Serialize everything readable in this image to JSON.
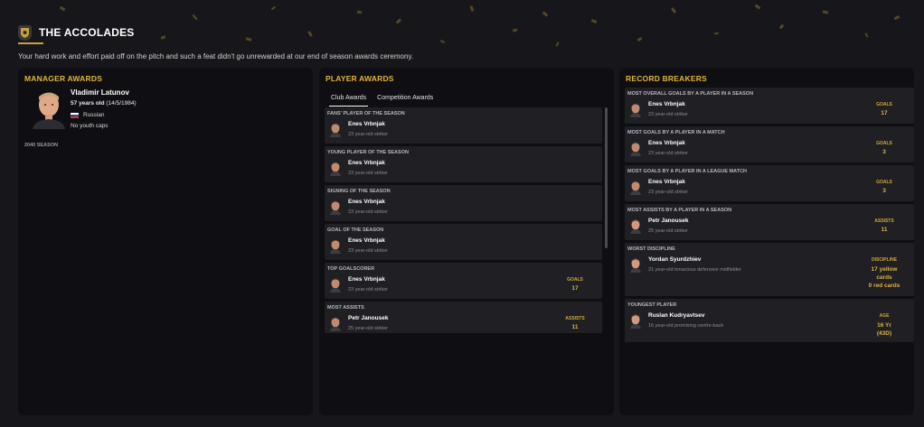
{
  "header": {
    "title": "THE ACCOLADES",
    "subtitle": "Your hard work and effort paid off on the pitch and such a feat didn't go unrewarded at our end of season awards ceremony."
  },
  "manager": {
    "panel_title": "MANAGER AWARDS",
    "name": "Vladimir Latunov",
    "age_bold": "57 years old",
    "age_dob": " (14/5/1984)",
    "nationality": "Russian",
    "caps": "No youth caps",
    "season": "2040 SEASON"
  },
  "player_awards": {
    "panel_title": "PLAYER AWARDS",
    "tabs": [
      "Club Awards",
      "Competition Awards"
    ],
    "awards": [
      {
        "title": "FANS' PLAYER OF THE SEASON",
        "player": "Enes Vrbnjak",
        "desc": "23 year-old striker",
        "stat_label": "",
        "stat_value": ""
      },
      {
        "title": "YOUNG PLAYER OF THE SEASON",
        "player": "Enes Vrbnjak",
        "desc": "23 year-old striker",
        "stat_label": "",
        "stat_value": ""
      },
      {
        "title": "SIGNING OF THE SEASON",
        "player": "Enes Vrbnjak",
        "desc": "23 year-old striker",
        "stat_label": "",
        "stat_value": ""
      },
      {
        "title": "GOAL OF THE SEASON",
        "player": "Enes Vrbnjak",
        "desc": "23 year-old striker",
        "stat_label": "",
        "stat_value": ""
      },
      {
        "title": "TOP GOALSCORER",
        "player": "Enes Vrbnjak",
        "desc": "23 year-old striker",
        "stat_label": "GOALS",
        "stat_value": "17"
      },
      {
        "title": "MOST ASSISTS",
        "player": "Petr Janousek",
        "desc": "25 year-old striker",
        "stat_label": "ASSISTS",
        "stat_value": "11"
      }
    ]
  },
  "records": {
    "panel_title": "RECORD BREAKERS",
    "items": [
      {
        "title": "MOST OVERALL GOALS BY A PLAYER IN A SEASON",
        "player": "Enes Vrbnjak",
        "desc": "23 year-old striker",
        "stat_label": "GOALS",
        "stat_value": "17"
      },
      {
        "title": "MOST GOALS BY A PLAYER IN A MATCH",
        "player": "Enes Vrbnjak",
        "desc": "23 year-old striker",
        "stat_label": "GOALS",
        "stat_value": "3"
      },
      {
        "title": "MOST GOALS BY A PLAYER IN A LEAGUE MATCH",
        "player": "Enes Vrbnjak",
        "desc": "23 year-old striker",
        "stat_label": "GOALS",
        "stat_value": "3"
      },
      {
        "title": "MOST ASSISTS BY A PLAYER IN A SEASON",
        "player": "Petr Janousek",
        "desc": "25 year-old striker",
        "stat_label": "ASSISTS",
        "stat_value": "11"
      },
      {
        "title": "WORST DISCIPLINE",
        "player": "Yordan Syurdzhiev",
        "desc": "21 year-old tenacious defensive midfielder",
        "stat_label": "DISCIPLINE",
        "stat_lines": [
          "17 yellow",
          "cards",
          "0 red cards"
        ]
      },
      {
        "title": "YOUNGEST PLAYER",
        "player": "Ruslan Kudryavtsev",
        "desc": "16 year-old promising centre-back",
        "stat_label": "AGE",
        "stat_lines": [
          "16 Yr",
          "(43D)"
        ]
      }
    ]
  },
  "colors": {
    "accent": "#e1b43b",
    "panel": "#0f0f13",
    "card": "#1f1f24",
    "background": "#17171b"
  }
}
